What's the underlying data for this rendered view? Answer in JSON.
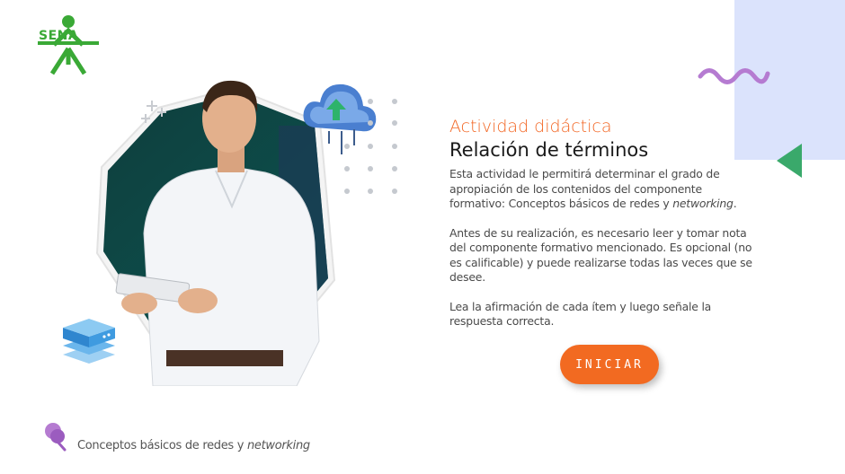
{
  "logo": {
    "text": "SENA",
    "color": "#3aa936"
  },
  "header": {
    "subtitle": "Actividad didáctica",
    "title": "Relación de términos"
  },
  "description": {
    "p1_text": "Esta actividad le permitirá determinar el grado de apropiación de los contenidos del componente formativo: Conceptos básicos de redes y ",
    "p1_italic": "networking",
    "p1_end": ".",
    "p2": "Antes de su realización, es necesario leer y tomar nota del componente formativo mencionado.  Es opcional (no es calificable) y puede realizarse todas las veces que se desee.",
    "p3": "Lea la afirmación de cada ítem y luego señale la respuesta correcta."
  },
  "start_button": {
    "label": "INICIAR",
    "color": "#f26a21"
  },
  "footer": {
    "text": "Conceptos básicos de redes y ",
    "italic": "networking"
  },
  "colors": {
    "accent": "#f26522",
    "deco_blue": "#dbe3fc",
    "deco_purple": "#b57bd1",
    "deco_green": "#3aa96b"
  },
  "icons": [
    "sena-logo-icon",
    "cloud-upload-icon",
    "server-icon",
    "sparkle-icon",
    "wave-icon",
    "triangle-icon",
    "pin-icon"
  ]
}
